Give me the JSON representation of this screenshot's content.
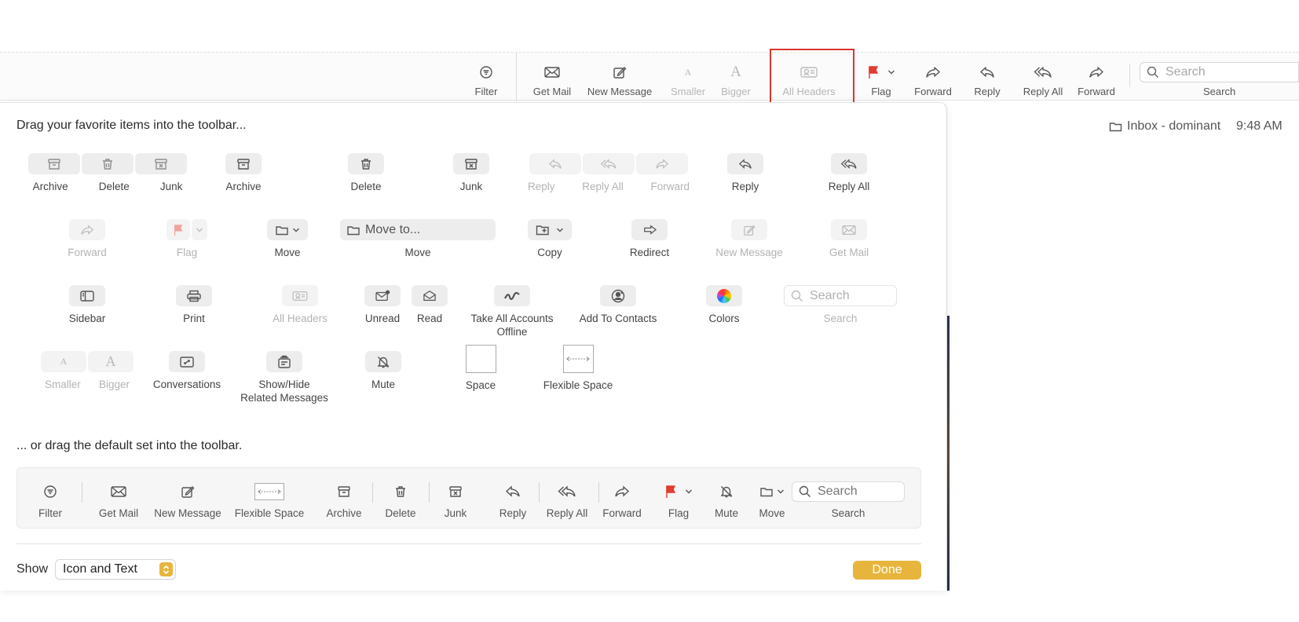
{
  "toolbar": {
    "filter": "Filter",
    "get_mail": "Get Mail",
    "new_message": "New Message",
    "smaller": "Smaller",
    "smaller_glyph": "A",
    "bigger": "Bigger",
    "bigger_glyph": "A",
    "all_headers": "All Headers",
    "flag": "Flag",
    "forward": "Forward",
    "reply": "Reply",
    "reply_all": "Reply All",
    "forward2": "Forward",
    "search_placeholder": "Search",
    "search_label": "Search"
  },
  "background": {
    "mailbox": "Inbox - dominant",
    "time": "9:48 AM"
  },
  "sheet": {
    "heading": "Drag your favorite items into the toolbar...",
    "row1": {
      "group_archive": "Archive",
      "group_delete": "Delete",
      "group_junk": "Junk",
      "archive": "Archive",
      "delete": "Delete",
      "junk": "Junk",
      "group_reply": "Reply",
      "group_reply_all": "Reply All",
      "group_forward": "Forward",
      "reply": "Reply",
      "reply_all": "Reply All"
    },
    "row2": {
      "forward": "Forward",
      "flag": "Flag",
      "move": "Move",
      "move_to_placeholder": "Move to...",
      "move2": "Move",
      "copy": "Copy",
      "redirect": "Redirect",
      "new_message": "New Message",
      "get_mail": "Get Mail"
    },
    "row3": {
      "sidebar": "Sidebar",
      "print": "Print",
      "all_headers": "All Headers",
      "unread": "Unread",
      "read": "Read",
      "offline_line1": "Take All Accounts",
      "offline_line2": "Offline",
      "add_contacts": "Add To Contacts",
      "colors": "Colors",
      "search_placeholder": "Search",
      "search_label": "Search"
    },
    "row4": {
      "smaller": "Smaller",
      "smaller_glyph": "A",
      "bigger": "Bigger",
      "bigger_glyph": "A",
      "conversations": "Conversations",
      "related_line1": "Show/Hide",
      "related_line2": "Related Messages",
      "mute": "Mute",
      "space": "Space",
      "flexible_space": "Flexible Space"
    },
    "default_heading": "... or drag the default set into the toolbar.",
    "default_set": {
      "filter": "Filter",
      "get_mail": "Get Mail",
      "new_message": "New Message",
      "flexible_space": "Flexible Space",
      "archive": "Archive",
      "delete": "Delete",
      "junk": "Junk",
      "reply": "Reply",
      "reply_all": "Reply All",
      "forward": "Forward",
      "flag": "Flag",
      "mute": "Mute",
      "move": "Move",
      "search_placeholder": "Search",
      "search_label": "Search"
    },
    "show_label": "Show",
    "show_value": "Icon and Text",
    "done": "Done"
  },
  "colors": {
    "accent": "#e8b53c",
    "flag_red": "#e23b30",
    "highlight": "#d9352f"
  }
}
